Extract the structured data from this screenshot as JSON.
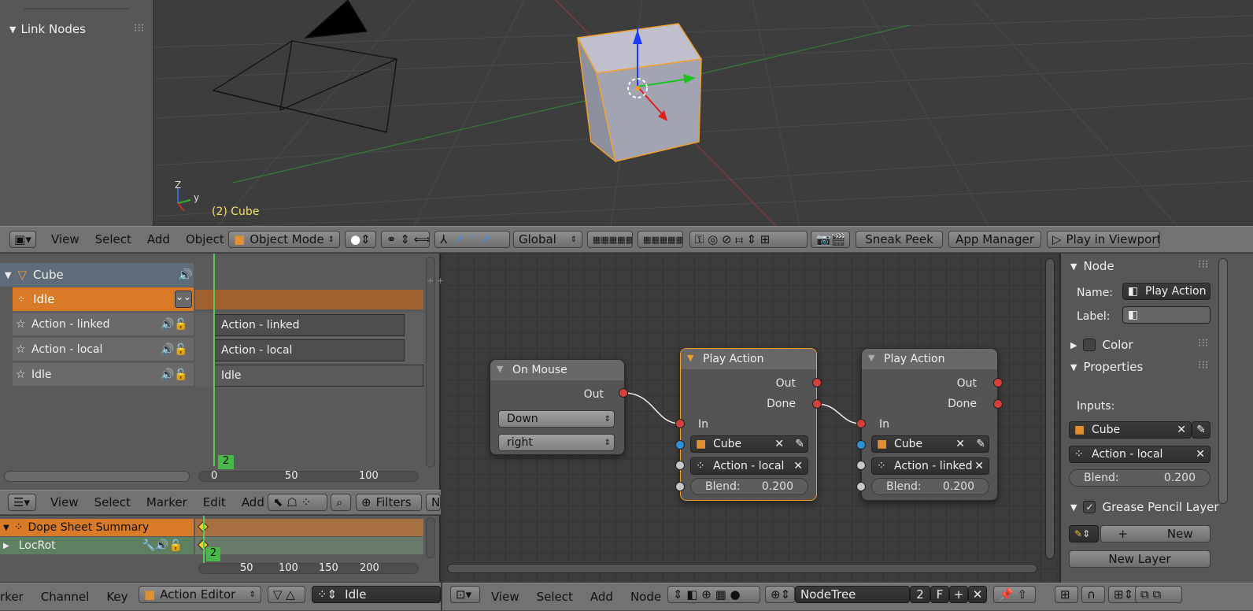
{
  "left_top_panel": {
    "heading": "Link Nodes"
  },
  "viewport": {
    "object_label": "(2) Cube",
    "axis_y": "y",
    "axis_z": "Z"
  },
  "view3d_header": {
    "menus": [
      "View",
      "Select",
      "Add",
      "Object"
    ],
    "mode": "Object Mode",
    "orientation": "Global",
    "buttons": [
      "Sneak Peek",
      "App Manager",
      "Play in Viewport"
    ]
  },
  "nla": {
    "object": "Cube",
    "active_track": "Idle",
    "tracks": [
      {
        "name": "Action - linked",
        "strip": "Action - linked"
      },
      {
        "name": "Action - local",
        "strip": "Action - local"
      },
      {
        "name": "Idle",
        "strip": "Idle"
      }
    ],
    "current_frame": "2",
    "ticks": [
      "0",
      "50",
      "100"
    ]
  },
  "dopesheet": {
    "menus": [
      "View",
      "Select",
      "Marker",
      "Edit",
      "Add"
    ],
    "filters_label": "Filters",
    "truncated": "N",
    "summary": "Dope Sheet Summary",
    "channel": "LocRot",
    "current_frame": "2",
    "ticks": [
      "50",
      "100",
      "150",
      "200"
    ],
    "footer_menus": [
      "rker",
      "Channel",
      "Key"
    ],
    "mode": "Action Editor",
    "action": "Idle"
  },
  "nodes": {
    "on_mouse": {
      "title": "On Mouse",
      "out": "Out",
      "event": "Down",
      "button": "right"
    },
    "play1": {
      "title": "Play Action",
      "out": "Out",
      "done": "Done",
      "in": "In",
      "object": "Cube",
      "action": "Action - local",
      "blend_label": "Blend:",
      "blend": "0.200"
    },
    "play2": {
      "title": "Play Action",
      "out": "Out",
      "done": "Done",
      "in": "In",
      "object": "Cube",
      "action": "Action - linked",
      "blend_label": "Blend:",
      "blend": "0.200"
    }
  },
  "node_footer": {
    "menus": [
      "View",
      "Select",
      "Add",
      "Node"
    ],
    "tree": "NodeTree",
    "users": "2",
    "fake": "F"
  },
  "sidebar": {
    "node_header": "Node",
    "name_label": "Name:",
    "name_value": "Play Action",
    "label_label": "Label:",
    "color_header": "Color",
    "properties_header": "Properties",
    "inputs_label": "Inputs:",
    "input_object": "Cube",
    "input_action": "Action - local",
    "blend_label": "Blend:",
    "blend_value": "0.200",
    "grease_header": "Grease Pencil Layer",
    "new_button": "New",
    "new_layer_button": "New Layer"
  }
}
